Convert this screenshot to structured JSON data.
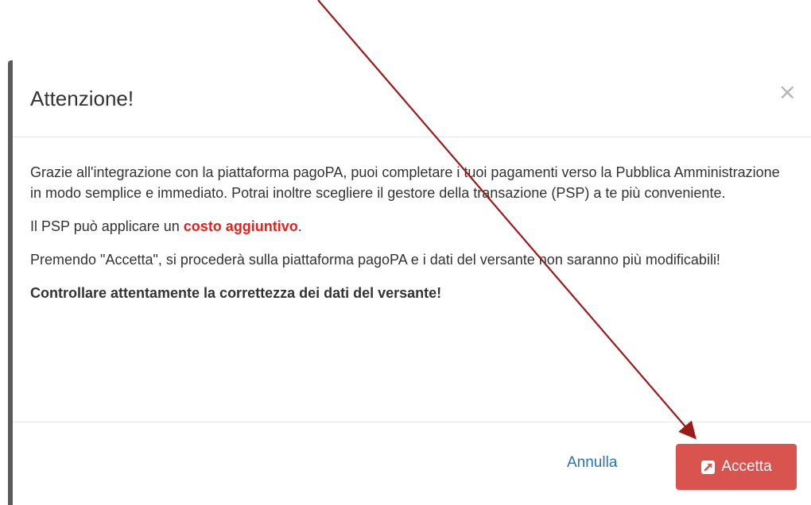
{
  "dialog": {
    "title": "Attenzione!",
    "close_symbol": "×",
    "body": {
      "p1": "Grazie all'integrazione con la piattaforma pagoPA, puoi completare i tuoi pagamenti verso la Pubblica Amministrazione in modo semplice e immediato. Potrai inoltre scegliere il gestore della transazione (PSP) a te più conveniente.",
      "p2_prefix": "Il PSP può applicare un ",
      "p2_highlight": "costo aggiuntivo",
      "p2_suffix": ".",
      "p3": "Premendo \"Accetta\", si procederà sulla piattaforma pagoPA e i dati del versante non saranno più modificabili!",
      "p4": "Controllare attentamente la correttezza dei dati del versante!"
    },
    "footer": {
      "cancel_label": "Annulla",
      "accept_label": "Accetta",
      "accept_icon": "external-link-square-icon"
    }
  },
  "colors": {
    "accept_button": "#d9534f",
    "cancel_link": "#2a73b6",
    "highlight_text": "#e8221b",
    "annotation_arrow": "#9b1b1b"
  },
  "annotation": {
    "arrow": "points-to-accept-button"
  }
}
